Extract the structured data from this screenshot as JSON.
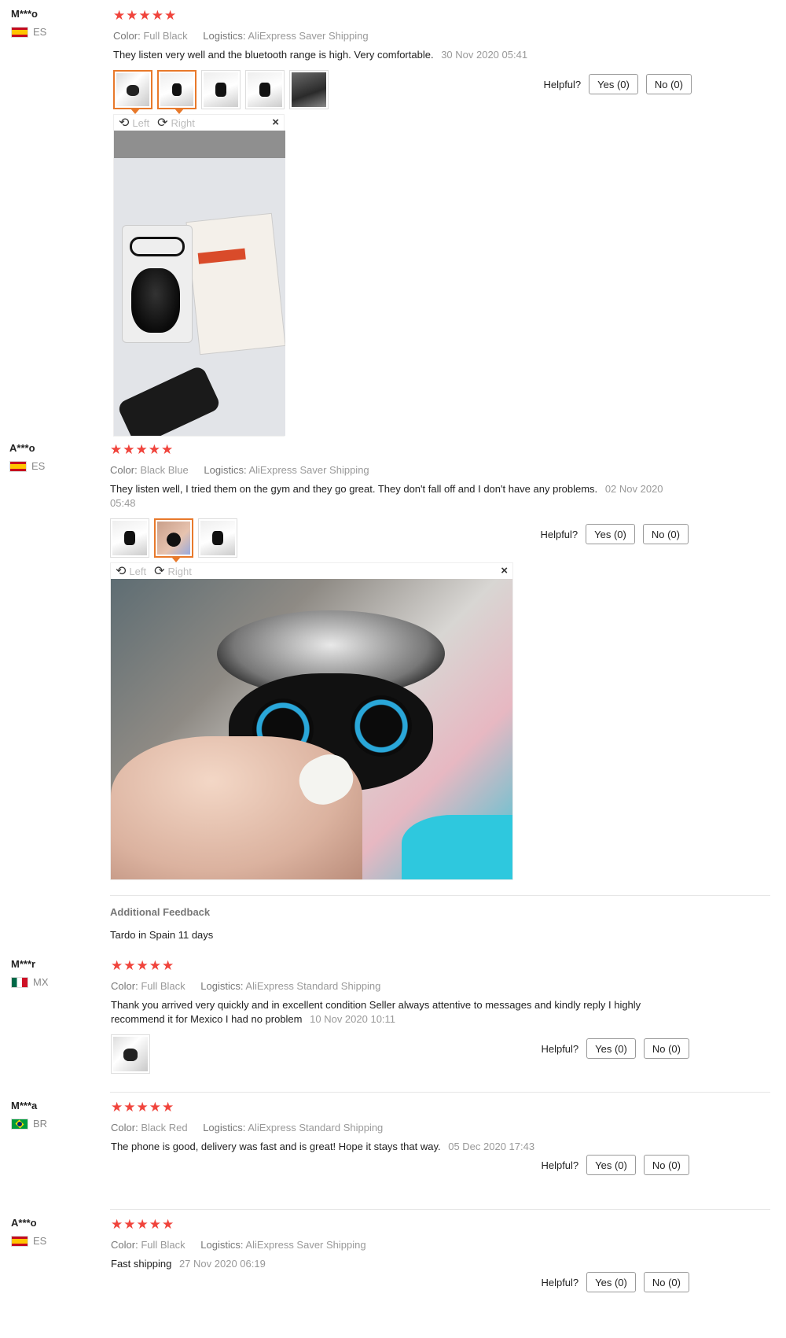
{
  "reviews": [
    {
      "user": "M***o",
      "country": "ES",
      "stars": "★★★★★",
      "color_label": "Color:",
      "color": "Full Black",
      "logistics_label": "Logistics:",
      "logistics": "AliExpress Saver Shipping",
      "text": "They listen very well and the bluetooth range is high. Very comfortable.",
      "date": "30 Nov 2020 05:41",
      "viewer": {
        "left": "Left",
        "right": "Right",
        "close": "×"
      }
    },
    {
      "user": "A***o",
      "country": "ES",
      "stars": "★★★★★",
      "color_label": "Color:",
      "color": "Black Blue",
      "logistics_label": "Logistics:",
      "logistics": "AliExpress Saver Shipping",
      "text": "They listen well, I tried them on the gym and they go great. They don't fall off and I don't have any problems.",
      "date": "02 Nov 2020 05:48",
      "viewer": {
        "left": "Left",
        "right": "Right",
        "close": "×"
      },
      "additional_title": "Additional Feedback",
      "additional_text": "Tardo in Spain 11 days"
    },
    {
      "user": "M***r",
      "country": "MX",
      "stars": "★★★★★",
      "color_label": "Color:",
      "color": "Full Black",
      "logistics_label": "Logistics:",
      "logistics": "AliExpress Standard Shipping",
      "text": "Thank you arrived very quickly and in excellent condition Seller always attentive to messages and kindly reply I highly recommend it for Mexico I had no problem",
      "date": "10 Nov 2020 10:11"
    },
    {
      "user": "M***a",
      "country": "BR",
      "stars": "★★★★★",
      "color_label": "Color:",
      "color": "Black Red",
      "logistics_label": "Logistics:",
      "logistics": "AliExpress Standard Shipping",
      "text": "The phone is good, delivery was fast and is great! Hope it stays that way.",
      "date": "05 Dec 2020 17:43"
    },
    {
      "user": "A***o",
      "country": "ES",
      "stars": "★★★★★",
      "color_label": "Color:",
      "color": "Full Black",
      "logistics_label": "Logistics:",
      "logistics": "AliExpress Saver Shipping",
      "text": "Fast shipping",
      "date": "27 Nov 2020 06:19"
    }
  ],
  "helpful": {
    "label": "Helpful?",
    "yes": "Yes (0)",
    "no": "No (0)"
  },
  "icons": {
    "rotate_left": "rotate-left-icon",
    "rotate_right": "rotate-right-icon",
    "close": "close-icon",
    "star": "star-icon"
  },
  "colors": {
    "star": "#f0443c",
    "active_thumb": "#e8792b",
    "muted_text": "#999999"
  }
}
